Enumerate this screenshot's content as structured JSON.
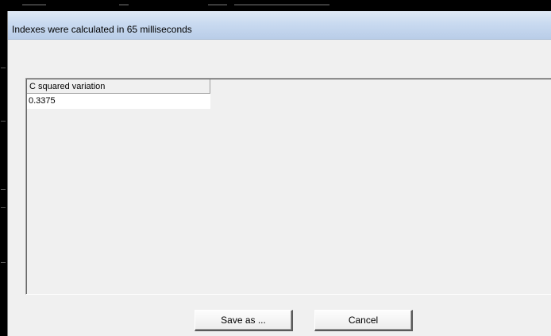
{
  "dialog": {
    "title": "Indexes were calculated in 65 milliseconds",
    "titlebar_color": "#c9daf0",
    "background_color": "#f0f0f0"
  },
  "results_list": {
    "columns": [
      "C squared variation"
    ],
    "rows": [
      [
        "0.3375"
      ]
    ]
  },
  "buttons": {
    "save_as_label": "Save as ...",
    "cancel_label": "Cancel"
  }
}
